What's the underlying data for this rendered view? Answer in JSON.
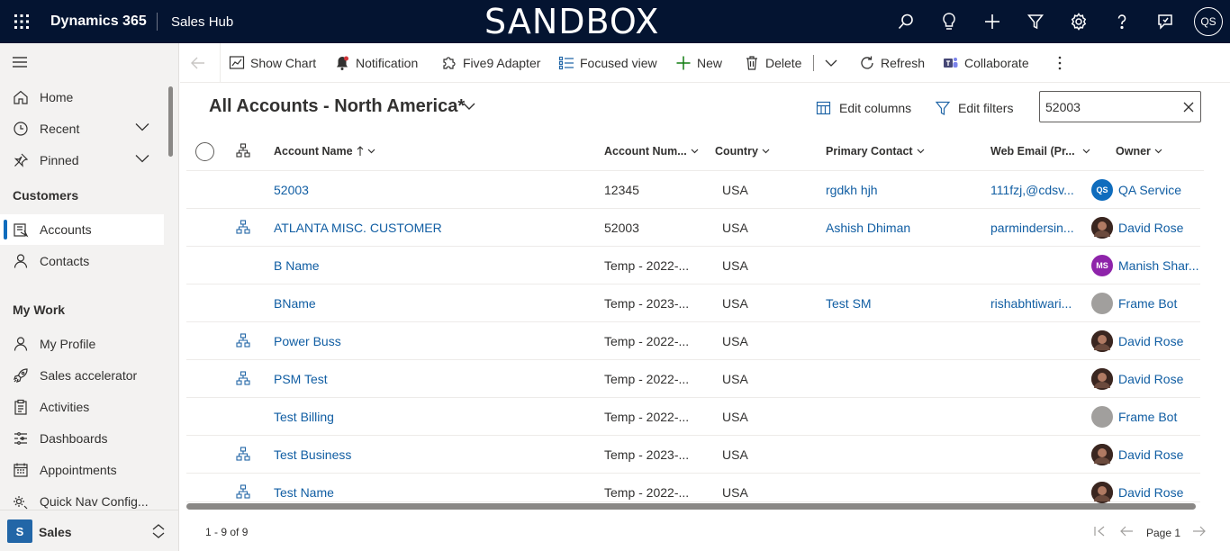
{
  "header": {
    "app_name": "Dynamics 365",
    "hub_name": "Sales Hub",
    "environment_banner": "SANDBOX",
    "user_initials": "QS",
    "icons": [
      "search-icon",
      "lightbulb-icon",
      "plus-icon",
      "filter-icon",
      "gear-icon",
      "help-icon",
      "feedback-icon"
    ]
  },
  "sidebar": {
    "top_items": [
      {
        "label": "Home",
        "icon": "home-icon"
      },
      {
        "label": "Recent",
        "icon": "clock-icon"
      },
      {
        "label": "Pinned",
        "icon": "pin-icon"
      }
    ],
    "groups": [
      {
        "title": "Customers",
        "items": [
          {
            "label": "Accounts",
            "icon": "accounts-icon",
            "active": true
          },
          {
            "label": "Contacts",
            "icon": "person-icon"
          }
        ]
      },
      {
        "title": "My Work",
        "items": [
          {
            "label": "My Profile",
            "icon": "person-icon"
          },
          {
            "label": "Sales accelerator",
            "icon": "rocket-icon"
          },
          {
            "label": "Activities",
            "icon": "clipboard-icon"
          },
          {
            "label": "Dashboards",
            "icon": "dashboard-icon"
          },
          {
            "label": "Appointments",
            "icon": "calendar-icon"
          },
          {
            "label": "Quick Nav Config...",
            "icon": "config-icon"
          }
        ]
      }
    ],
    "area": {
      "badge": "S",
      "name": "Sales"
    }
  },
  "commands": {
    "show_chart": "Show Chart",
    "notification": "Notification",
    "five9": "Five9 Adapter",
    "focused_view": "Focused view",
    "new": "New",
    "delete": "Delete",
    "refresh": "Refresh",
    "collaborate": "Collaborate"
  },
  "view": {
    "title": "All Accounts - North America*",
    "edit_columns": "Edit columns",
    "edit_filters": "Edit filters",
    "search_value": "52003"
  },
  "grid": {
    "columns": {
      "account_name": "Account Name",
      "account_number": "Account Num...",
      "country": "Country",
      "primary_contact": "Primary Contact",
      "web_email": "Web Email (Pr...",
      "owner": "Owner"
    },
    "rows": [
      {
        "hier": false,
        "name": "52003",
        "number": "12345",
        "country": "USA",
        "contact": "rgdkh hjh",
        "email": "111fzj,@cdsv...",
        "owner": "QA Service",
        "owner_avatar": {
          "type": "initials",
          "text": "QS",
          "color": "#0f6cbd"
        }
      },
      {
        "hier": true,
        "name": "ATLANTA MISC. CUSTOMER",
        "number": "52003",
        "country": "USA",
        "contact": "Ashish Dhiman",
        "email": "parmindersin...",
        "owner": "David Rose",
        "owner_avatar": {
          "type": "photo",
          "text": "",
          "color": "#5a3a30"
        }
      },
      {
        "hier": false,
        "name": "B Name",
        "number": "Temp - 2022-...",
        "country": "USA",
        "contact": "",
        "email": "",
        "owner": "Manish Shar...",
        "owner_avatar": {
          "type": "initials",
          "text": "MS",
          "color": "#8e24aa"
        }
      },
      {
        "hier": false,
        "name": "BName",
        "number": "Temp - 2023-...",
        "country": "USA",
        "contact": "Test SM",
        "email": "rishabhtiwari...",
        "owner": "Frame Bot",
        "owner_avatar": {
          "type": "blank",
          "text": "",
          "color": "#a19f9d"
        }
      },
      {
        "hier": true,
        "name": "Power Buss",
        "number": "Temp - 2022-...",
        "country": "USA",
        "contact": "",
        "email": "",
        "owner": "David Rose",
        "owner_avatar": {
          "type": "photo",
          "text": "",
          "color": "#5a3a30"
        }
      },
      {
        "hier": true,
        "name": "PSM Test",
        "number": "Temp - 2022-...",
        "country": "USA",
        "contact": "",
        "email": "",
        "owner": "David Rose",
        "owner_avatar": {
          "type": "photo",
          "text": "",
          "color": "#5a3a30"
        }
      },
      {
        "hier": false,
        "name": "Test Billing",
        "number": "Temp - 2022-...",
        "country": "USA",
        "contact": "",
        "email": "",
        "owner": "Frame Bot",
        "owner_avatar": {
          "type": "blank",
          "text": "",
          "color": "#a19f9d"
        }
      },
      {
        "hier": true,
        "name": "Test Business",
        "number": "Temp - 2023-...",
        "country": "USA",
        "contact": "",
        "email": "",
        "owner": "David Rose",
        "owner_avatar": {
          "type": "photo",
          "text": "",
          "color": "#5a3a30"
        }
      },
      {
        "hier": true,
        "name": "Test Name",
        "number": "Temp - 2022-...",
        "country": "USA",
        "contact": "",
        "email": "",
        "owner": "David Rose",
        "owner_avatar": {
          "type": "photo",
          "text": "",
          "color": "#5a3a30"
        }
      }
    ]
  },
  "footer": {
    "record_count": "1 - 9 of 9",
    "page_label": "Page 1"
  },
  "colors": {
    "topbar": "#041431",
    "link": "#115ea3",
    "accent": "#0f6cbd"
  }
}
